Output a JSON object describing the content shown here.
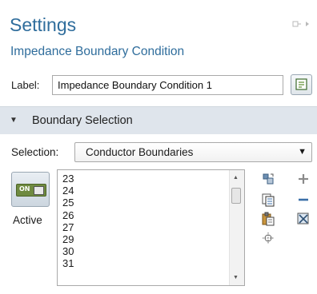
{
  "settings": {
    "title": "Settings",
    "subtitle": "Impedance Boundary Condition"
  },
  "label_row": {
    "label": "Label:",
    "value": "Impedance Boundary Condition 1"
  },
  "boundary_selection": {
    "header": "Boundary Selection",
    "selection_label": "Selection:",
    "selection_value": "Conductor Boundaries",
    "toggle_text": "ON",
    "active_label": "Active",
    "items": [
      "23",
      "24",
      "25",
      "26",
      "27",
      "29",
      "30",
      "31"
    ]
  },
  "icons": {
    "pin": "pin-icon",
    "label_action": "text-edit-icon",
    "paste_selection": "paste-selection-icon",
    "copy_selection": "copy-selection-icon",
    "paste": "paste-icon",
    "zoom_selected": "zoom-to-selection-icon",
    "add": "plus-icon",
    "remove": "minus-icon",
    "clear_selection": "clear-selection-icon"
  },
  "colors": {
    "title": "#2f6d9c",
    "section_header_bg": "#dfe5ec",
    "add_icon": "#8a8a8a",
    "remove_icon": "#3a6fa8"
  }
}
